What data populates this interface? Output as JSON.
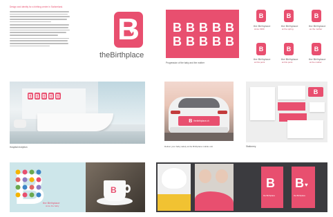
{
  "colors": {
    "brand_pink": "#e84f6f",
    "dark_gray": "#3b3b3f",
    "light_teal": "#cde6ea"
  },
  "intro": {
    "heading": "Design and identity for a birthing centre in Switzerland."
  },
  "logo": {
    "letter": "B",
    "wordmark_the": "the",
    "wordmark_name": "Birthplace"
  },
  "variations": {
    "caption": "Progression of the baby and the mother",
    "letters": [
      "B",
      "B",
      "B",
      "B",
      "B",
      "B",
      "B",
      "B",
      "B",
      "B"
    ]
  },
  "logo_grid": {
    "letter": "B",
    "items": [
      {
        "name": "the Birthplace",
        "sub": "since 1990"
      },
      {
        "name": "the Birthplace",
        "sub": "at the spring"
      },
      {
        "name": "the Birthplace",
        "sub": "as the mother"
      },
      {
        "name": "the Birthplace",
        "sub": "at this point"
      },
      {
        "name": "the Birthplace",
        "sub": "at this point"
      },
      {
        "name": "the Birthplace",
        "sub": "at the mother"
      }
    ]
  },
  "reception": {
    "caption": "Hospital reception",
    "sign_letters": [
      "B",
      "B",
      "B",
      "B",
      "B"
    ]
  },
  "car": {
    "caption": "Deliver your baby safely at the Birthplace mobile unit",
    "plate": "thebirthplace.ch",
    "plate_b": "B"
  },
  "stationery": {
    "caption": "Stationery",
    "card_letter": "B"
  },
  "book": {
    "letter": "B",
    "title": "the Birthplace",
    "sub": "since the baby"
  },
  "mug": {
    "letter": "B"
  },
  "posters": {
    "letter_1": "B",
    "letter_2": "B",
    "label_1": "the Birthplace",
    "label_2": "the Birthplace"
  }
}
